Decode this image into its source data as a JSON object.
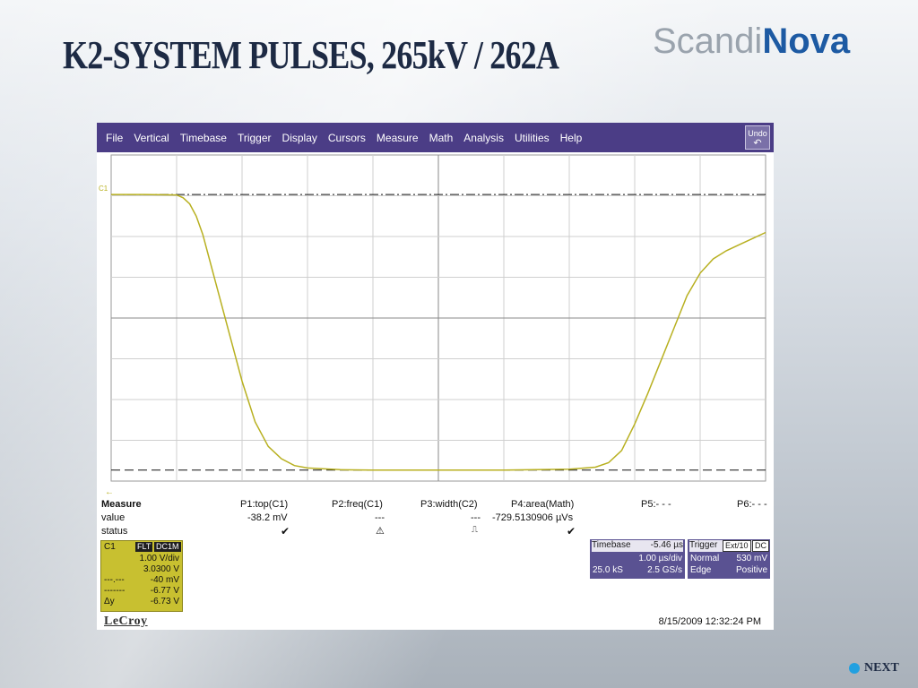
{
  "slide": {
    "title": "K2-SYSTEM PULSES, 265kV / 262A",
    "logo_part1": "Scandi",
    "logo_part2": "Nova",
    "next_label": "NEXT"
  },
  "scope": {
    "menu": [
      "File",
      "Vertical",
      "Timebase",
      "Trigger",
      "Display",
      "Cursors",
      "Measure",
      "Math",
      "Analysis",
      "Utilities",
      "Help"
    ],
    "undo_label": "Undo",
    "channel_marker": "C1",
    "measure": {
      "headers": [
        "Measure",
        "P1:top(C1)",
        "P2:freq(C1)",
        "P3:width(C2)",
        "P4:area(Math)",
        "P5:- - -",
        "P6:- - -"
      ],
      "value_label": "value",
      "values": [
        "-38.2 mV",
        "---",
        "---",
        "-729.5130906 µVs"
      ],
      "status_label": "status"
    },
    "channel_box": {
      "name": "C1",
      "tags": [
        "FLT",
        "DC1M"
      ],
      "rows": [
        {
          "k": "",
          "v": "1.00 V/div"
        },
        {
          "k": "",
          "v": "3.0300 V"
        },
        {
          "k": "---.---",
          "v": "-40 mV"
        },
        {
          "k": "-------",
          "v": "-6.77 V"
        },
        {
          "k": "Δy",
          "v": "-6.73 V"
        }
      ]
    },
    "timebase_box": {
      "title": "Timebase",
      "delay": "-5.46 µs",
      "rate": "1.00 µs/div",
      "samples": "25.0 kS",
      "sample_rate": "2.5 GS/s"
    },
    "trigger_box": {
      "title": "Trigger",
      "tags": [
        "Ext/10",
        "DC"
      ],
      "mode": "Normal",
      "level": "530 mV",
      "type": "Edge",
      "slope": "Positive"
    },
    "brand": "LeCroy",
    "timestamp": "8/15/2009 12:32:24 PM",
    "colors": {
      "menu_bg": "#4b3d86",
      "trace": "#b8b020",
      "channel_bg": "#c8c030",
      "info_bg": "#5a5292"
    }
  },
  "chart_data": {
    "type": "line",
    "series": [
      {
        "x": [
          0,
          0.5,
          1.0,
          1.1,
          1.2,
          1.3,
          1.4,
          1.5,
          1.6,
          1.7,
          1.8,
          1.9,
          2.0,
          2.2,
          2.4,
          2.6,
          2.8,
          3.0,
          3.5,
          4.0,
          5.0,
          6.0,
          7.0,
          7.4,
          7.6,
          7.8,
          8.0,
          8.2,
          8.4,
          8.6,
          8.8,
          9.0,
          9.2,
          9.4,
          9.6,
          9.8,
          10.0
        ],
        "y": [
          3.03,
          3.03,
          3.02,
          2.95,
          2.8,
          2.5,
          2.05,
          1.45,
          0.85,
          0.25,
          -0.35,
          -0.95,
          -1.55,
          -2.55,
          -3.15,
          -3.45,
          -3.62,
          -3.68,
          -3.72,
          -3.73,
          -3.73,
          -3.73,
          -3.71,
          -3.66,
          -3.55,
          -3.25,
          -2.6,
          -1.85,
          -1.05,
          -0.25,
          0.55,
          1.1,
          1.45,
          1.65,
          1.8,
          1.95,
          2.1
        ]
      }
    ],
    "xlim": [
      0,
      10
    ],
    "ylim": [
      -4,
      4
    ],
    "grid": true,
    "reference_lines": [
      3.03,
      -3.73
    ]
  }
}
